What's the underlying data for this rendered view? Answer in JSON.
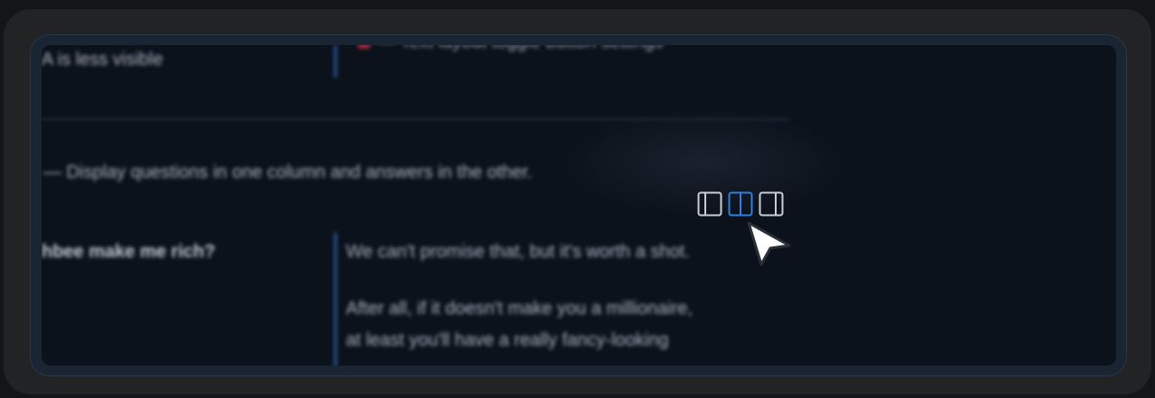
{
  "content": {
    "top_left_text": "A is less visible",
    "top_right_text": "— Text layout toggle button settings",
    "section_description": "— Display questions in one column and answers in the other.",
    "faq": {
      "question": "hbee make me rich?",
      "answer_line1": "We can't promise that, but it's worth a shot.",
      "answer_line2": "After all, if it doesn't make you a millionaire,",
      "answer_line3": "at least you'll have a really fancy-looking"
    }
  },
  "layout_toggle": {
    "options": [
      {
        "name": "left-panel-layout-icon",
        "state": "inactive"
      },
      {
        "name": "two-column-layout-icon",
        "state": "active"
      },
      {
        "name": "right-panel-layout-icon",
        "state": "inactive"
      }
    ],
    "active_color": "#2f7fe0",
    "inactive_color": "#c9ced6"
  },
  "colors": {
    "background": "#0c121c",
    "column_divider": "#2a5da8",
    "frame": "#222325"
  },
  "cursor": {
    "name": "arrow-cursor-icon"
  }
}
